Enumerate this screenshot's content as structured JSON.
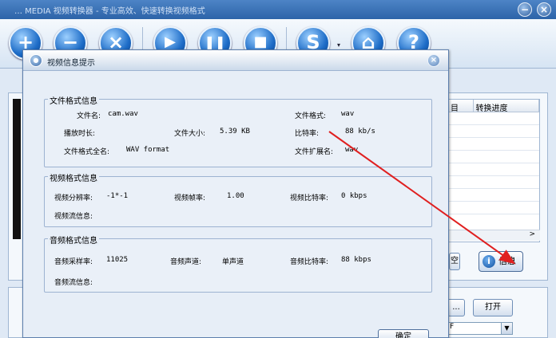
{
  "main_window": {
    "title": "… MEDIA 视频转换器 - 专业高效、快速转换视频格式",
    "minimize_glyph": "−",
    "close_glyph": "×"
  },
  "toolbar": {
    "buttons": [
      {
        "name": "add",
        "glyph": "+"
      },
      {
        "name": "remove",
        "glyph": "−"
      },
      {
        "name": "clear",
        "glyph": "×"
      },
      {
        "name": "play",
        "glyph": "▶"
      },
      {
        "name": "pause",
        "glyph": "❚❚"
      },
      {
        "name": "stop",
        "glyph": "■"
      },
      {
        "name": "settings",
        "glyph": "S"
      },
      {
        "name": "home",
        "glyph": "⌂"
      },
      {
        "name": "help",
        "glyph": "?"
      }
    ],
    "caret": "▾"
  },
  "file_list": {
    "columns": [
      "目",
      "转换进度"
    ]
  },
  "background_buttons": {
    "partial_button": "空",
    "info_label": "信息",
    "browse_label": "...",
    "open_label": "打开",
    "select_value": "F"
  },
  "dialog": {
    "title": "视频信息提示",
    "close_glyph": "×",
    "file_info": {
      "group_title": "文件格式信息",
      "filename_label": "文件名:",
      "filename_value": "cam.wav",
      "format_label": "文件格式:",
      "format_value": "wav",
      "duration_label": "播放时长:",
      "duration_value": "",
      "size_label": "文件大小:",
      "size_value": "5.39 KB",
      "bitrate_label": "比特率:",
      "bitrate_value": "88 kb/s",
      "fullname_label": "文件格式全名:",
      "fullname_value": "WAV format",
      "ext_label": "文件扩展名:",
      "ext_value": "wav"
    },
    "video_info": {
      "group_title": "视频格式信息",
      "resolution_label": "视频分辨率:",
      "resolution_value": "-1*-1",
      "framerate_label": "视频帧率:",
      "framerate_value": "1.00",
      "bitrate_label": "视频比特率:",
      "bitrate_value": "0  kbps",
      "stream_label": "视频流信息:",
      "stream_value": ""
    },
    "audio_info": {
      "group_title": "音频格式信息",
      "samplerate_label": "音频采样率:",
      "samplerate_value": "11025",
      "channels_label": "音频声道:",
      "channels_value": "单声道",
      "bitrate_label": "音频比特率:",
      "bitrate_value": "88  kbps",
      "stream_label": "音频流信息:",
      "stream_value": ""
    },
    "ok_label": "确定"
  },
  "colors": {
    "annotation_arrow": "#e02020",
    "accent": "#1d6cc7"
  }
}
